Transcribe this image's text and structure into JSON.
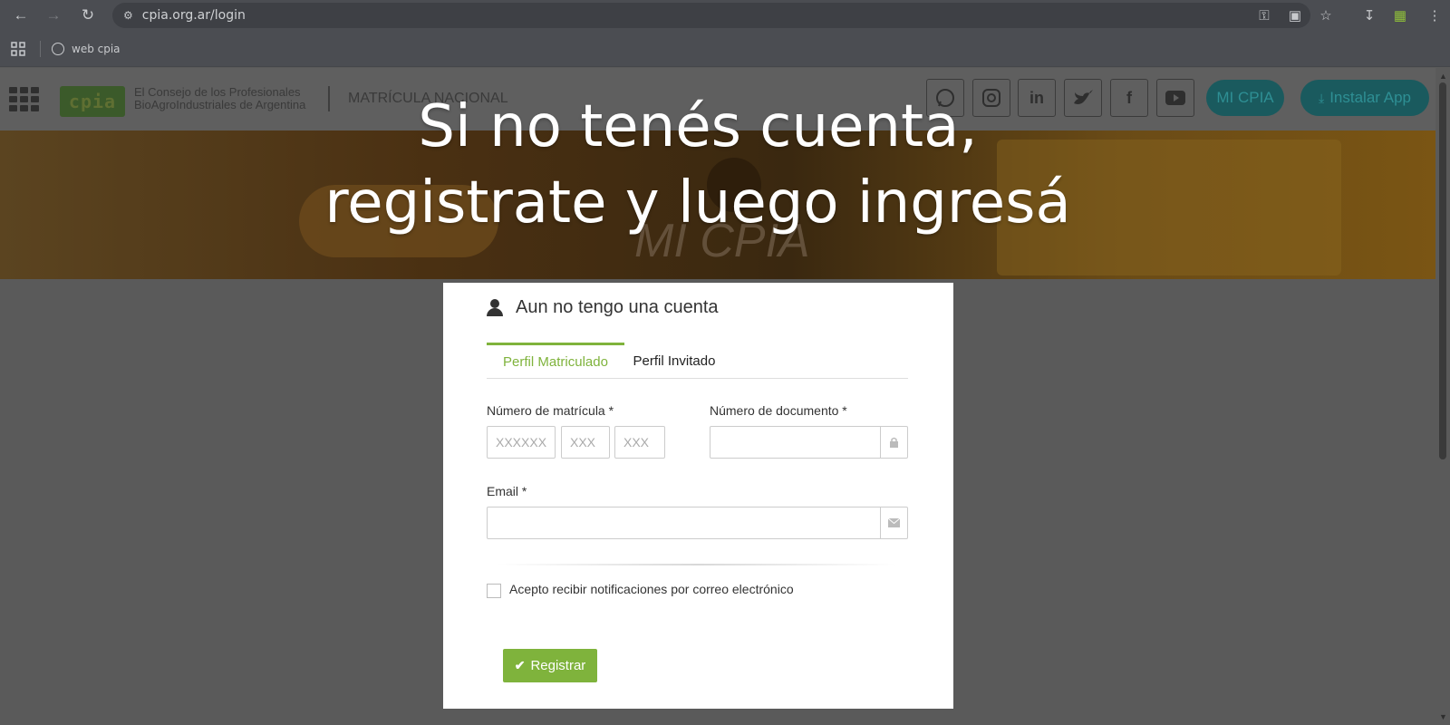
{
  "browser": {
    "url": "cpia.org.ar/login",
    "bookmark_label": "web cpia"
  },
  "header": {
    "logo_text": "cpia",
    "org_line1": "El Consejo de los Profesionales",
    "org_line2": "BioAgroIndustriales de Argentina",
    "section_title": "MATRÍCULA NACIONAL",
    "mi_cpia_label": "MI CPIA",
    "install_label": "Instalar App"
  },
  "hero": {
    "watermark": "MI CPIA",
    "overlay_line1": "Si no tenés cuenta,",
    "overlay_line2": "registrate y luego ingresá"
  },
  "card": {
    "title": "Aun no tengo una cuenta",
    "tabs": [
      {
        "label": "Perfil Matriculado",
        "active": true
      },
      {
        "label": "Perfil Invitado",
        "active": false
      }
    ],
    "matricula_label": "Número de matrícula *",
    "matricula_placeholders": [
      "XXXXXX",
      "XXX",
      "XXX"
    ],
    "documento_label": "Número de documento *",
    "documento_value": "",
    "email_label": "Email *",
    "email_value": "",
    "checkbox_label": "Acepto recibir notificaciones por correo electrónico",
    "checkbox_checked": false,
    "register_label": "Registrar"
  },
  "colors": {
    "accent_green": "#7fb33c",
    "teal_button": "#1a5a5e",
    "browser_chrome": "#4b4d52"
  },
  "icons": [
    "back-icon",
    "forward-icon",
    "reload-icon",
    "site-settings-icon",
    "password-key-icon",
    "install-icon",
    "star-icon",
    "download-icon",
    "extension-icon",
    "menu-dots-icon",
    "apps-icon",
    "globe-icon",
    "whatsapp-icon",
    "instagram-icon",
    "linkedin-icon",
    "twitter-icon",
    "facebook-icon",
    "youtube-icon",
    "user-icon",
    "lock-icon",
    "envelope-icon",
    "check-icon"
  ]
}
